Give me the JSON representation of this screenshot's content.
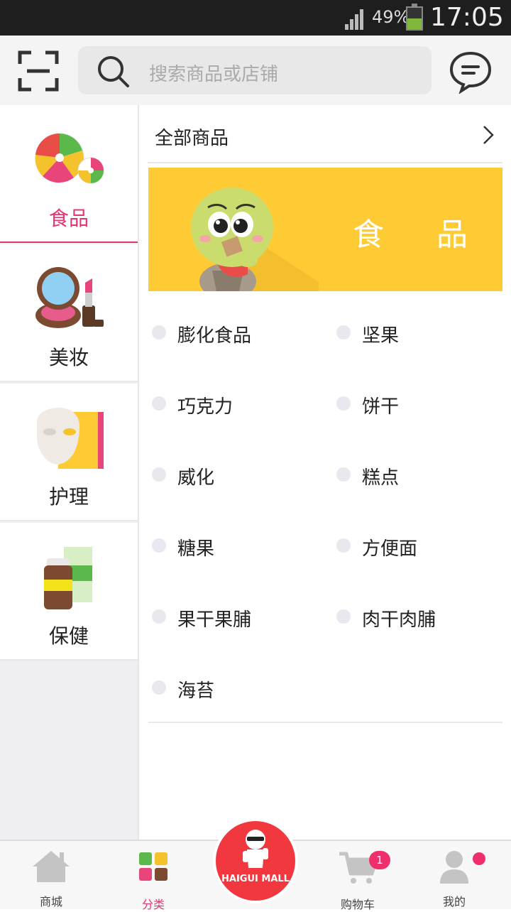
{
  "status_bar": {
    "battery_percent": "49%",
    "battery_level": 0.49,
    "time": "17:05"
  },
  "search": {
    "placeholder": "搜索商品或店铺"
  },
  "sidebar": {
    "items": [
      {
        "label": "食品",
        "icon": "candy-icon",
        "active": true
      },
      {
        "label": "美妆",
        "icon": "makeup-icon",
        "active": false
      },
      {
        "label": "护理",
        "icon": "face-mask-icon",
        "active": false
      },
      {
        "label": "保健",
        "icon": "supplement-icon",
        "active": false
      }
    ]
  },
  "content": {
    "all_label": "全部商品",
    "banner_title": "食 品",
    "subcategories": [
      "膨化食品",
      "坚果",
      "巧克力",
      "饼干",
      "威化",
      "糕点",
      "糖果",
      "方便面",
      "果干果脯",
      "肉干肉脯",
      "海苔"
    ]
  },
  "bottom_nav": {
    "items": [
      {
        "label": "商城",
        "icon": "house-icon"
      },
      {
        "label": "分类",
        "icon": "category-grid-icon",
        "active": true
      },
      {
        "label": "购物车",
        "icon": "cart-icon",
        "badge": "1"
      },
      {
        "label": "我的",
        "icon": "profile-icon"
      }
    ],
    "center_logo_text": "HAIGUI MALL"
  },
  "colors": {
    "accent": "#e5356f",
    "banner": "#fecb35",
    "logo": "#f1383f"
  }
}
